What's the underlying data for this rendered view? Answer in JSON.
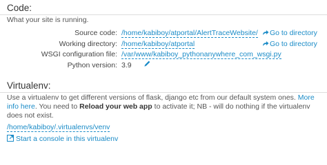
{
  "code": {
    "title": "Code:",
    "subtitle": "What your site is running.",
    "rows": [
      {
        "label": "Source code:",
        "value": "/home/kabiboy/atportal/AlertTraceWebsite/",
        "action": "Go to directory"
      },
      {
        "label": "Working directory:",
        "value": "/home/kabiboy/atportal",
        "action": "Go to directory"
      },
      {
        "label": "WSGI configuration file:",
        "value": "/var/www/kabiboy_pythonanywhere_com_wsgi.py"
      },
      {
        "label": "Python version:",
        "value": "3.9"
      }
    ]
  },
  "virtualenv": {
    "title": "Virtualenv:",
    "desc_part1": "Use a virtualenv to get different versions of flask, django etc from our default system ones.",
    "more_info": "More info here",
    "desc_part2": ". You need to",
    "reload_bold": "Reload your web app",
    "desc_part3": "to activate it; NB - will do nothing if the virtualenv does not exist.",
    "path": "/home/kabiboy/.virtualenvs/venv",
    "console_link": "Start a console in this virtualenv"
  },
  "colors": {
    "link": "#1a8bc7",
    "text": "#555555"
  },
  "icons": {
    "goto": "arrow-icon",
    "edit": "pencil-icon",
    "console": "console-icon"
  }
}
